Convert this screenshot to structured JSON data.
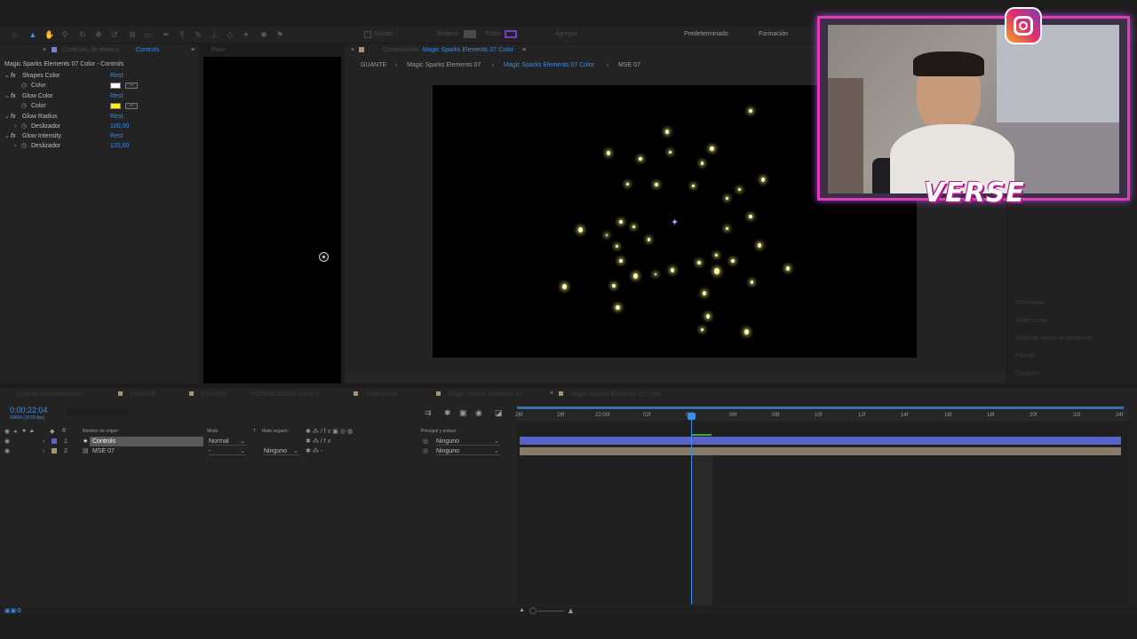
{
  "toolbar": {
    "ws_default": "Predeterminado",
    "ws_training": "Formación",
    "snap": "Ajustar",
    "fill": "Relleno",
    "stroke": "Trazo",
    "add": "Agregar"
  },
  "fx_panel": {
    "tab_label": "Controles de efectos",
    "tab_active": "Controls",
    "layer_path": "Magic Sparks Elements 07 Color - Controls",
    "effects": [
      {
        "name": "Shapes Color",
        "reset": "Rest",
        "prop": "Color",
        "value": "",
        "swatch": "#ffffff"
      },
      {
        "name": "Glow Color",
        "reset": "Rest",
        "prop": "Color",
        "value": "",
        "swatch": "#fff200"
      },
      {
        "name": "Glow Radius",
        "reset": "Rest",
        "prop": "Deslizador",
        "value": "100,00"
      },
      {
        "name": "Glow Intensity",
        "reset": "Rest",
        "prop": "Deslizador",
        "value": "120,00"
      }
    ]
  },
  "flow_panel": {
    "title": "Flow"
  },
  "comp_panel": {
    "title": "Composición",
    "comp_name": "Magic Sparks Elements 07 Color",
    "breadcrumbs": [
      "GUANTE",
      "Magic Sparks Elements 07",
      "Magic Sparks Elements 07 Color",
      "MSE 07"
    ],
    "timecode": "0:00:22:04"
  },
  "right_panel": {
    "items": [
      "Bibliotecas",
      "Seleccionar",
      "Rellenar según el contenido",
      "Párrafo",
      "Carácter"
    ]
  },
  "timeline": {
    "tabs": [
      "Cola de procesamiento",
      "GUANTE",
      "GUANTE",
      "POTENCIADOR Comp 1",
      "Final Comp",
      "Magic Sparks Elements 07",
      "Magic Sparks Elements 07 Color"
    ],
    "current_time": "0:00:22:04",
    "fps_note": "00664 (30.00 fps)",
    "col_source": "Nombre de origen",
    "col_mode": "Modo",
    "col_t": "T",
    "col_track": "Mate seguim.",
    "col_parent": "Principal y enlace",
    "ruler": [
      "26f",
      "28f",
      "22:00f",
      "02f",
      "04f",
      "06f",
      "08f",
      "10f",
      "12f",
      "14f",
      "16f",
      "18f",
      "20f",
      "22f",
      "24f"
    ],
    "layers": [
      {
        "num": "1",
        "name": "Controls",
        "mode": "Normal",
        "track": "",
        "parent": "Ninguno",
        "color": "#5a62c8"
      },
      {
        "num": "2",
        "name": "MSE 07",
        "mode": "-",
        "track": "Ninguno",
        "parent": "Ninguno",
        "color": "#a89278"
      }
    ]
  },
  "webcam": {
    "logo_text": "VERSE"
  }
}
